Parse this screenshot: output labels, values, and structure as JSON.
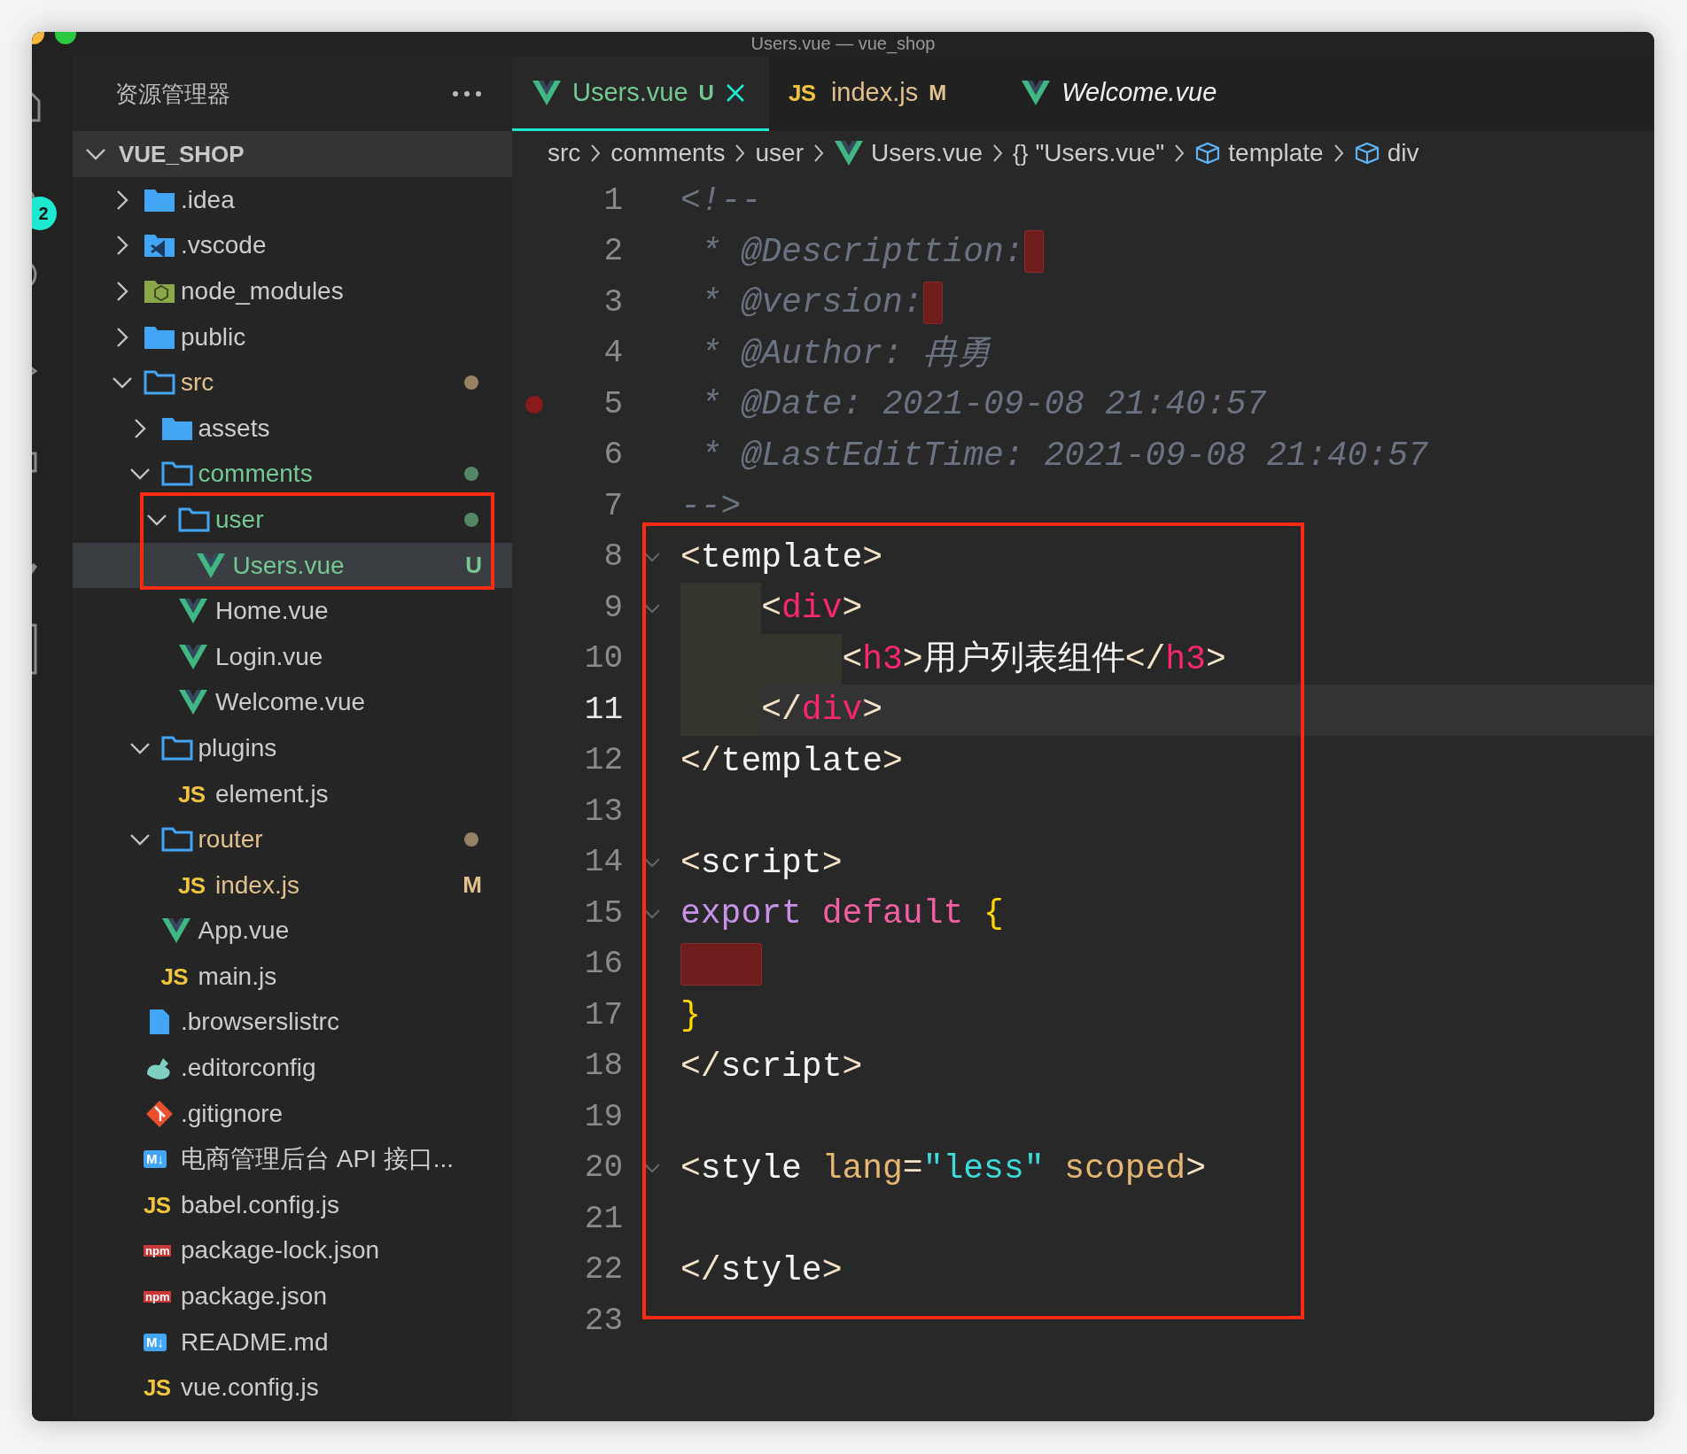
{
  "window": {
    "title": "Users.vue — vue_shop"
  },
  "activity_bar": {
    "badge": "2"
  },
  "sidebar": {
    "title": "资源管理器",
    "section": {
      "label": "VUE_SHOP",
      "expanded": true
    },
    "tree": [
      {
        "name": ".idea",
        "kind": "folder",
        "expanded": false,
        "selected": false
      },
      {
        "name": ".vscode",
        "kind": "vscode-folder",
        "expanded": false,
        "selected": false
      },
      {
        "name": "node_modules",
        "kind": "node-folder",
        "expanded": false,
        "selected": false
      },
      {
        "name": "public",
        "kind": "folder",
        "expanded": false,
        "selected": false
      },
      {
        "name": "src",
        "kind": "folder",
        "expanded": true,
        "color": "#e2c08d",
        "selected": false,
        "children": [
          {
            "name": "assets",
            "kind": "folder",
            "expanded": false,
            "selected": false
          },
          {
            "name": "comments",
            "kind": "folder",
            "expanded": true,
            "color": "#73c991",
            "selected": false,
            "children": [
              {
                "name": "user",
                "kind": "folder",
                "expanded": true,
                "color": "#73c991",
                "selected": false,
                "children": [
                  {
                    "name": "Users.vue",
                    "kind": "vue",
                    "color": "#73c991",
                    "badge": "U",
                    "selected": true
                  }
                ]
              },
              {
                "name": "Home.vue",
                "kind": "vue",
                "selected": false
              },
              {
                "name": "Login.vue",
                "kind": "vue",
                "selected": false
              },
              {
                "name": "Welcome.vue",
                "kind": "vue",
                "selected": false
              }
            ]
          },
          {
            "name": "plugins",
            "kind": "folder",
            "expanded": true,
            "selected": false,
            "children": [
              {
                "name": "element.js",
                "kind": "js",
                "icon_label": "JS",
                "selected": false
              }
            ]
          },
          {
            "name": "router",
            "kind": "folder",
            "expanded": true,
            "color": "#e2c08d",
            "selected": false,
            "children": [
              {
                "name": "index.js",
                "kind": "js",
                "icon_label": "JS",
                "color": "#e2c08d",
                "badge": "M",
                "selected": false
              }
            ]
          },
          {
            "name": "App.vue",
            "kind": "vue",
            "selected": false
          },
          {
            "name": "main.js",
            "kind": "js",
            "icon_label": "JS",
            "selected": false
          }
        ]
      },
      {
        "name": ".browserslistrc",
        "kind": "file",
        "selected": false
      },
      {
        "name": ".editorconfig",
        "kind": "editorconfig",
        "selected": false
      },
      {
        "name": ".gitignore",
        "kind": "git",
        "selected": false
      },
      {
        "name": "电商管理后台 API 接口...",
        "kind": "md",
        "icon_label": "M↓",
        "selected": false
      },
      {
        "name": "babel.config.js",
        "kind": "js",
        "icon_label": "JS",
        "selected": false
      },
      {
        "name": "package-lock.json",
        "kind": "npm",
        "icon_label": "npm",
        "selected": false
      },
      {
        "name": "package.json",
        "kind": "npm",
        "icon_label": "npm",
        "selected": false
      },
      {
        "name": "README.md",
        "kind": "md",
        "icon_label": "M↓",
        "selected": false
      },
      {
        "name": "vue.config.js",
        "kind": "js",
        "icon_label": "JS",
        "selected": false
      }
    ]
  },
  "tabs": [
    {
      "label": "Users.vue",
      "kind": "vue",
      "badge": "U",
      "color": "#73c991",
      "selected": true,
      "preview": false
    },
    {
      "label": "index.js",
      "kind": "js",
      "icon_label": "JS",
      "badge": "M",
      "color": "#e2c08d",
      "selected": false,
      "preview": false
    },
    {
      "label": "Welcome.vue",
      "kind": "vue",
      "selected": false,
      "preview": true
    }
  ],
  "breadcrumbs": [
    {
      "text": "src",
      "kind": "folder"
    },
    {
      "text": "comments",
      "kind": "folder"
    },
    {
      "text": "user",
      "kind": "folder"
    },
    {
      "text": "Users.vue",
      "kind": "vue"
    },
    {
      "text": "\"Users.vue\"",
      "kind": "module",
      "symbol": "{}"
    },
    {
      "text": "template",
      "kind": "element"
    },
    {
      "text": "div",
      "kind": "element"
    }
  ],
  "code": [
    {
      "number": "1",
      "fold": false,
      "breakpoint": false,
      "current": false,
      "error_mark": false,
      "tokens": [
        {
          "text": "<!--",
          "kind": "comment"
        }
      ]
    },
    {
      "number": "2",
      "fold": false,
      "breakpoint": false,
      "current": false,
      "error_mark": true,
      "tokens": [
        {
          "text": " * @Descripttion:",
          "kind": "comment"
        }
      ]
    },
    {
      "number": "3",
      "fold": false,
      "breakpoint": false,
      "current": false,
      "error_mark": true,
      "tokens": [
        {
          "text": " * @version:",
          "kind": "comment"
        }
      ]
    },
    {
      "number": "4",
      "fold": false,
      "breakpoint": false,
      "current": false,
      "error_mark": false,
      "tokens": [
        {
          "text": " * @Author: 冉勇",
          "kind": "comment"
        }
      ]
    },
    {
      "number": "5",
      "fold": false,
      "breakpoint": true,
      "current": false,
      "error_mark": false,
      "tokens": [
        {
          "text": " * @Date: 2021-09-08 21:40:57",
          "kind": "comment"
        }
      ]
    },
    {
      "number": "6",
      "fold": false,
      "breakpoint": false,
      "current": false,
      "error_mark": false,
      "tokens": [
        {
          "text": " * @LastEditTime: 2021-09-08 21:40:57",
          "kind": "comment"
        }
      ]
    },
    {
      "number": "7",
      "fold": false,
      "breakpoint": false,
      "current": false,
      "error_mark": false,
      "tokens": [
        {
          "text": "-->",
          "kind": "comment"
        }
      ]
    },
    {
      "number": "8",
      "fold": true,
      "breakpoint": false,
      "current": false,
      "error_mark": false,
      "tokens": [
        {
          "text": "<",
          "kind": "punct"
        },
        {
          "text": "template",
          "kind": "component"
        },
        {
          "text": ">",
          "kind": "punct"
        }
      ]
    },
    {
      "number": "9",
      "fold": true,
      "breakpoint": false,
      "current": false,
      "error_mark": false,
      "tokens": [
        {
          "text": "    <",
          "kind": "punct"
        },
        {
          "text": "div",
          "kind": "tag"
        },
        {
          "text": ">",
          "kind": "punct"
        }
      ]
    },
    {
      "number": "10",
      "fold": false,
      "breakpoint": false,
      "current": false,
      "error_mark": false,
      "tokens": [
        {
          "text": "        <",
          "kind": "punct"
        },
        {
          "text": "h3",
          "kind": "tag"
        },
        {
          "text": ">",
          "kind": "punct"
        },
        {
          "text": "用户列表组件",
          "kind": "text"
        },
        {
          "text": "</",
          "kind": "punct"
        },
        {
          "text": "h3",
          "kind": "tag"
        },
        {
          "text": ">",
          "kind": "punct"
        }
      ]
    },
    {
      "number": "11",
      "fold": false,
      "breakpoint": false,
      "current": true,
      "error_mark": false,
      "tokens": [
        {
          "text": "    </",
          "kind": "punct"
        },
        {
          "text": "div",
          "kind": "tag"
        },
        {
          "text": ">",
          "kind": "punct"
        }
      ]
    },
    {
      "number": "12",
      "fold": false,
      "breakpoint": false,
      "current": false,
      "error_mark": false,
      "tokens": [
        {
          "text": "</",
          "kind": "punct"
        },
        {
          "text": "template",
          "kind": "component"
        },
        {
          "text": ">",
          "kind": "punct"
        }
      ]
    },
    {
      "number": "13",
      "fold": false,
      "breakpoint": false,
      "current": false,
      "error_mark": false
    },
    {
      "number": "14",
      "fold": true,
      "breakpoint": false,
      "current": false,
      "error_mark": false,
      "tokens": [
        {
          "text": "<",
          "kind": "punct"
        },
        {
          "text": "script",
          "kind": "component"
        },
        {
          "text": ">",
          "kind": "punct"
        }
      ]
    },
    {
      "number": "15",
      "fold": true,
      "breakpoint": false,
      "current": false,
      "error_mark": false,
      "tokens": [
        {
          "text": "export ",
          "kind": "keyword"
        },
        {
          "text": "default ",
          "kind": "modifier"
        },
        {
          "text": "{",
          "kind": "brace"
        }
      ]
    },
    {
      "number": "16",
      "fold": false,
      "breakpoint": false,
      "current": false,
      "error_mark": true
    },
    {
      "number": "17",
      "fold": false,
      "breakpoint": false,
      "current": false,
      "error_mark": false,
      "tokens": [
        {
          "text": "}",
          "kind": "brace"
        }
      ]
    },
    {
      "number": "18",
      "fold": false,
      "breakpoint": false,
      "current": false,
      "error_mark": false,
      "tokens": [
        {
          "text": "</",
          "kind": "punct"
        },
        {
          "text": "script",
          "kind": "component"
        },
        {
          "text": ">",
          "kind": "punct"
        }
      ]
    },
    {
      "number": "19",
      "fold": false,
      "breakpoint": false,
      "current": false,
      "error_mark": false
    },
    {
      "number": "20",
      "fold": true,
      "breakpoint": false,
      "current": false,
      "error_mark": false,
      "tokens": [
        {
          "text": "<",
          "kind": "punct"
        },
        {
          "text": "style ",
          "kind": "component"
        },
        {
          "text": "lang",
          "kind": "attribute"
        },
        {
          "text": "=",
          "kind": "punct"
        },
        {
          "text": "\"less\" ",
          "kind": "string"
        },
        {
          "text": "scoped",
          "kind": "attribute"
        },
        {
          "text": ">",
          "kind": "punct"
        }
      ]
    },
    {
      "number": "21",
      "fold": false,
      "breakpoint": false,
      "current": false,
      "error_mark": false
    },
    {
      "number": "22",
      "fold": false,
      "breakpoint": false,
      "current": false,
      "error_mark": false,
      "tokens": [
        {
          "text": "</",
          "kind": "punct"
        },
        {
          "text": "style",
          "kind": "component"
        },
        {
          "text": ">",
          "kind": "punct"
        }
      ]
    },
    {
      "number": "23",
      "fold": false,
      "breakpoint": false,
      "current": false,
      "error_mark": false
    }
  ]
}
